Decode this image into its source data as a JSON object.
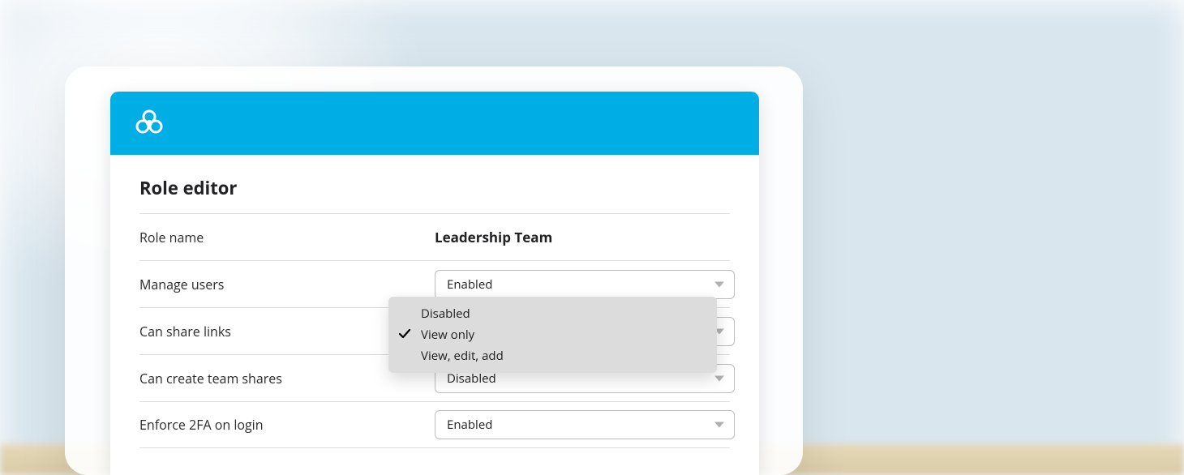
{
  "colors": {
    "accent": "#00aee6"
  },
  "panel": {
    "title": "Role editor",
    "rows": [
      {
        "label": "Role name",
        "value": "Leadership Team"
      },
      {
        "label": "Manage users",
        "value": "Enabled"
      },
      {
        "label": "Can share links",
        "value": "View only"
      },
      {
        "label": "Can create team shares",
        "value": "Disabled"
      },
      {
        "label": "Enforce 2FA on login",
        "value": "Enabled"
      }
    ]
  },
  "open_dropdown": {
    "for_row_label": "Can share links",
    "options": [
      {
        "label": "Disabled",
        "selected": false
      },
      {
        "label": "View only",
        "selected": true
      },
      {
        "label": "View, edit, add",
        "selected": false
      }
    ]
  }
}
